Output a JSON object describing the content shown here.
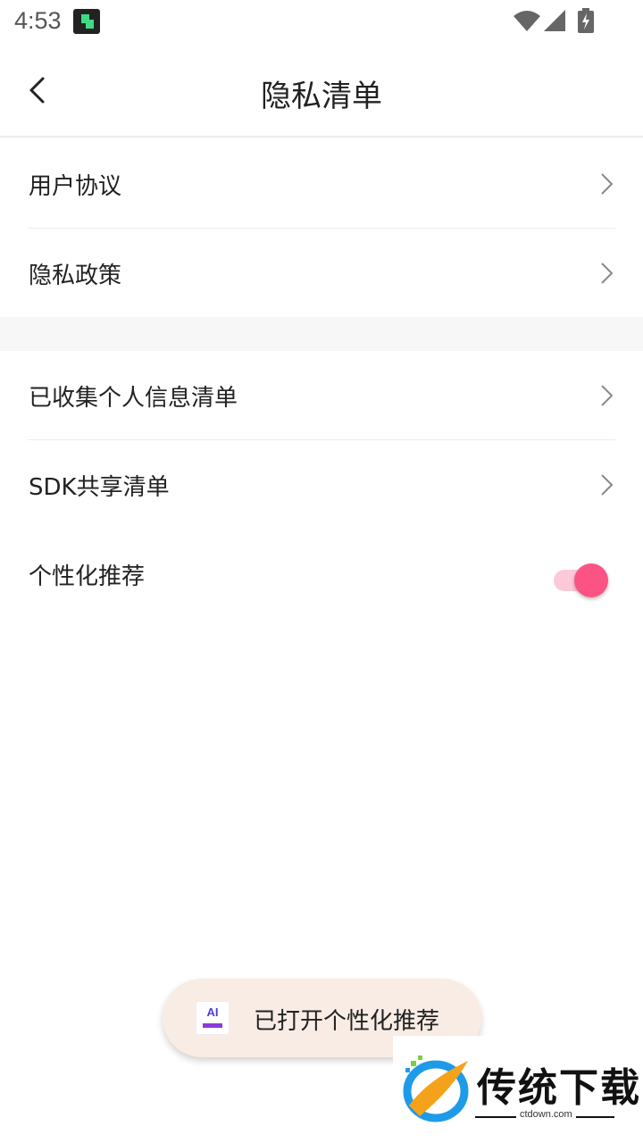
{
  "status_bar": {
    "time": "4:53",
    "icons": [
      "app-notification-icon",
      "wifi-icon",
      "signal-icon",
      "battery-charging-icon"
    ]
  },
  "header": {
    "title": "隐私清单",
    "back_icon": "chevron-left-icon"
  },
  "list": {
    "group1": [
      {
        "label": "用户协议",
        "icon": "chevron-right-icon"
      },
      {
        "label": "隐私政策",
        "icon": "chevron-right-icon"
      }
    ],
    "group2": [
      {
        "label": "已收集个人信息清单",
        "icon": "chevron-right-icon"
      },
      {
        "label": "SDK共享清单",
        "icon": "chevron-right-icon"
      }
    ],
    "toggle_item": {
      "label": "个性化推荐",
      "state": "on"
    }
  },
  "toast": {
    "icon_text": "AI",
    "text": "已打开个性化推荐"
  },
  "watermark": {
    "text": "传统下载",
    "domain": "ctdown.com"
  },
  "colors": {
    "accent": "#fb5383",
    "toggle_track": "#fcc9d8",
    "toast_bg": "#f8ece5",
    "divider": "#ececec",
    "section_gap": "#f7f7f7"
  }
}
